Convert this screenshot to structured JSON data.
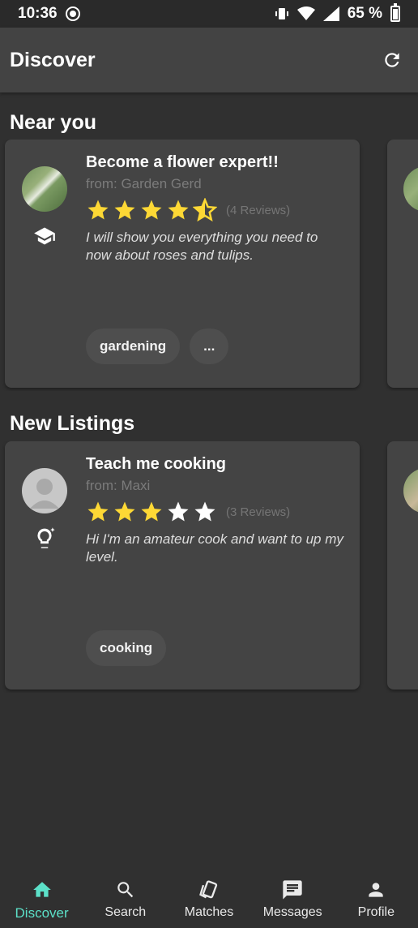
{
  "status_bar": {
    "time": "10:36",
    "battery": "65 %"
  },
  "app_bar": {
    "title": "Discover"
  },
  "sections": [
    {
      "title": "Near you",
      "card": {
        "title": "Become a flower expert!!",
        "from": "from: Garden Gerd",
        "rating": 4.5,
        "reviews": "(4 Reviews)",
        "description": "I will show you everything you need to now about roses and tulips.",
        "role_icon": "graduation-cap-icon",
        "chips": [
          "gardening",
          "..."
        ]
      }
    },
    {
      "title": "New Listings",
      "card": {
        "title": "Teach me cooking",
        "from": "from: Maxi",
        "rating": 3,
        "reviews": "(3 Reviews)",
        "description": "Hi I'm an amateur cook and want to up my level.",
        "role_icon": "lightbulb-icon",
        "chips": [
          "cooking"
        ]
      }
    }
  ],
  "bottom_nav": [
    {
      "label": "Discover",
      "icon": "home-icon",
      "active": true
    },
    {
      "label": "Search",
      "icon": "search-icon",
      "active": false
    },
    {
      "label": "Matches",
      "icon": "cards-icon",
      "active": false
    },
    {
      "label": "Messages",
      "icon": "message-icon",
      "active": false
    },
    {
      "label": "Profile",
      "icon": "person-icon",
      "active": false
    }
  ],
  "colors": {
    "accent": "#5ce0c8",
    "star": "#fdd835",
    "card": "#444444",
    "background": "#303030"
  }
}
